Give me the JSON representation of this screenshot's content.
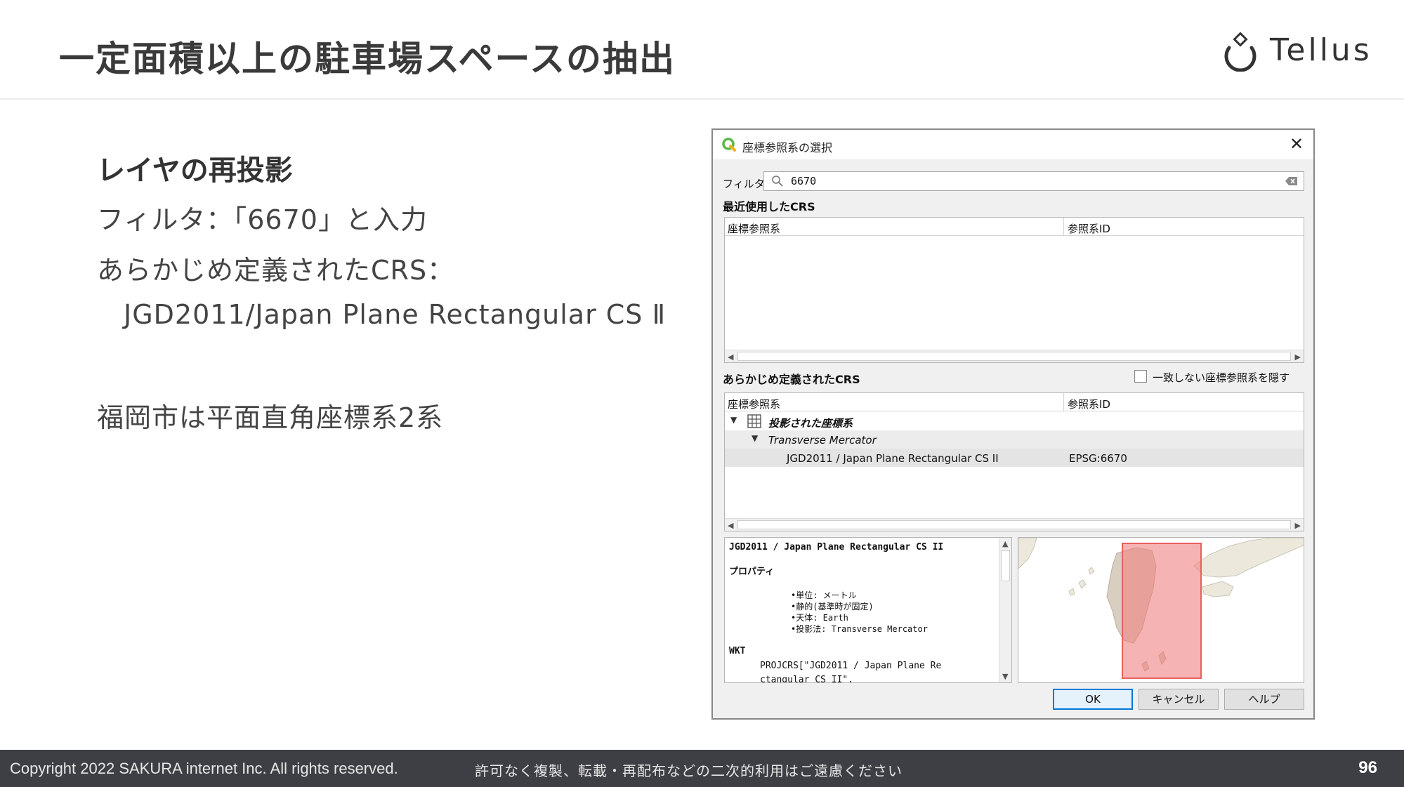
{
  "slide": {
    "title": "一定面積以上の駐車場スペースの抽出",
    "logo_text": "Tellus",
    "section_title": "レイヤの再投影",
    "lines": [
      "フィルタ：「6670」と入力",
      "あらかじめ定義されたCRS：",
      "JGD2011/Japan Plane Rectangular CS Ⅱ",
      "福岡市は平面直角座標系2系"
    ]
  },
  "dialog": {
    "title": "座標参照系の選択",
    "filter_label": "フィルタ",
    "filter_value": "6670",
    "recent_label": "最近使用したCRS",
    "predefined_label": "あらかじめ定義されたCRS",
    "hide_unmatched_label": "一致しない座標参照系を隠す",
    "columns": [
      "座標参照系",
      "参照系ID"
    ],
    "tree": {
      "group": "投影された座標系",
      "subgroup": "Transverse Mercator",
      "selected_name": "JGD2011 / Japan Plane Rectangular CS II",
      "selected_id": "EPSG:6670"
    },
    "details": {
      "title": "JGD2011 / Japan Plane Rectangular CS II",
      "properties_heading": "プロパティ",
      "properties": [
        "•単位: メートル",
        "•静的(基準時が固定)",
        "•天体: Earth",
        "•投影法: Transverse Mercator"
      ],
      "wkt_heading": "WKT",
      "wkt_lines": [
        "PROJCRS[\"JGD2011 / Japan Plane Re",
        "ctangular CS II\","
      ]
    },
    "buttons": {
      "ok": "OK",
      "cancel": "キャンセル",
      "help": "ヘルプ"
    }
  },
  "footer": {
    "copyright": "Copyright 2022 SAKURA internet Inc. All rights reserved.",
    "notice": "許可なく複製、転載・再配布などの二次的利用はご遠慮ください",
    "page_number": "96"
  },
  "colors": {
    "footer_bg": "#3d3f44",
    "highlight_extent": "#f08080",
    "qgis_green": "#58b947",
    "ok_border": "#0078d7"
  }
}
